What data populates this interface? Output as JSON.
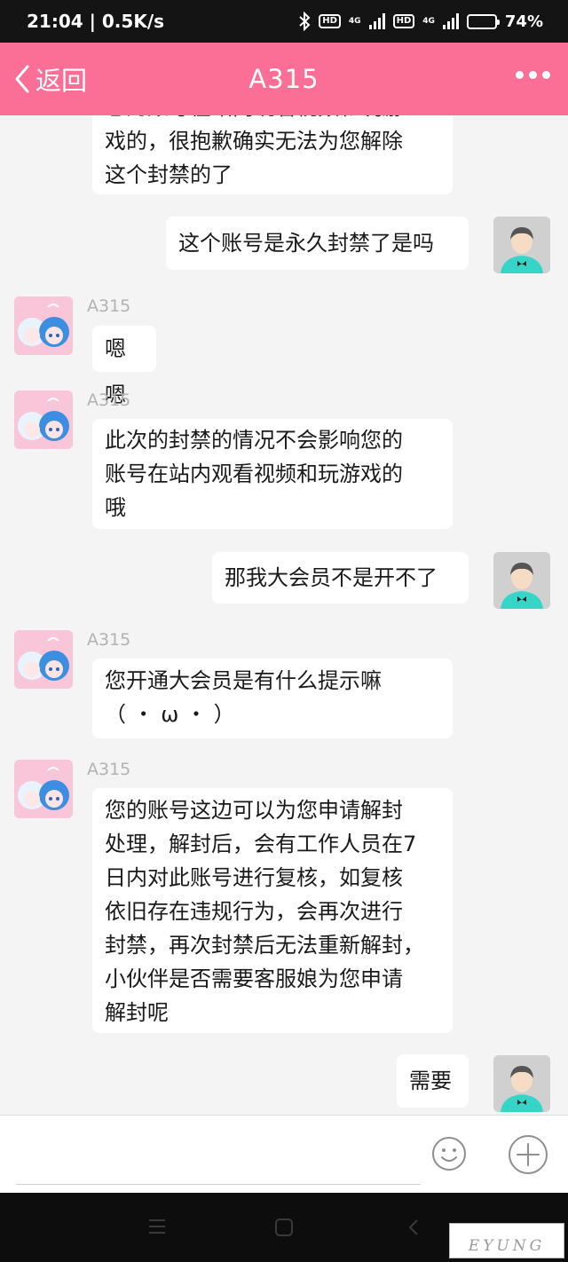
{
  "status_bar": {
    "time_speed": "21:04 | 0.5K/s",
    "net_label_1": "4G",
    "net_label_2": "4G",
    "hd_label": "HD",
    "battery": "74%",
    "battery_level": 0.74
  },
  "nav": {
    "back_label": "返回",
    "title": "A315"
  },
  "messages": [
    {
      "from": "agent",
      "sender": "",
      "text": "您的账号在站内观看视频和玩游\n戏的，很抱歉确实无法为您解除\n这个封禁的了"
    },
    {
      "from": "user",
      "text": "这个账号是永久封禁了是吗"
    },
    {
      "from": "agent",
      "sender": "A315",
      "text": "嗯嗯"
    },
    {
      "from": "agent",
      "sender": "A315",
      "text": "此次的封禁的情况不会影响您的\n账号在站内观看视频和玩游戏的\n哦"
    },
    {
      "from": "user",
      "text": "那我大会员不是开不了"
    },
    {
      "from": "agent",
      "sender": "A315",
      "text": "您开通大会员是有什么提示嘛\n（ ・ ω ・ ）"
    },
    {
      "from": "agent",
      "sender": "A315",
      "text": "您的账号这边可以为您申请解封\n处理，解封后，会有工作人员在7\n日内对此账号进行复核，如复核\n依旧存在违规行为，会再次进行\n封禁，再次封禁后无法重新解封，\n小伙伴是否需要客服娘为您申请\n解封呢"
    },
    {
      "from": "user",
      "text": "需要"
    }
  ],
  "input": {
    "placeholder": "",
    "emoji_icon": "smiley-icon",
    "plus_icon": "plus-circle-icon"
  },
  "watermark": "EYUNG",
  "colors": {
    "header": "#fb6f97",
    "background": "#f4f4f4",
    "bubble": "#ffffff"
  }
}
